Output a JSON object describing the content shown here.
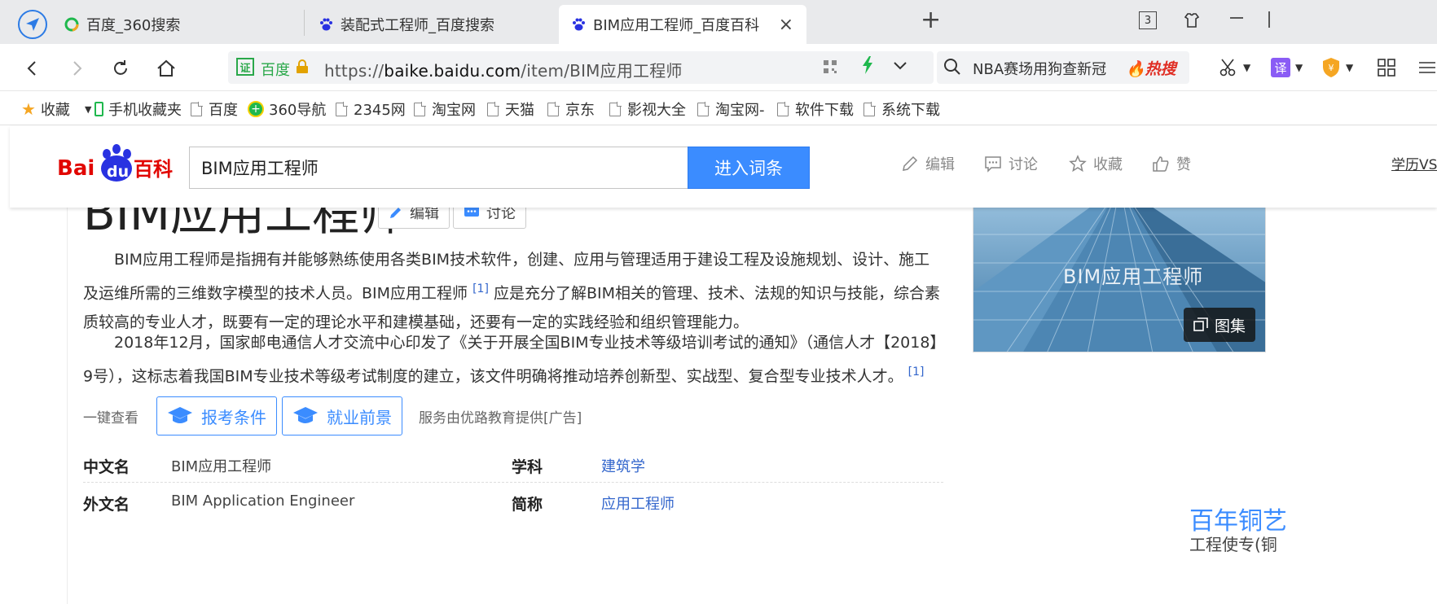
{
  "browser": {
    "tabs": [
      {
        "label": "百度_360搜索"
      },
      {
        "label": "装配式工程师_百度搜索"
      },
      {
        "label": "BIM应用工程师_百度百科",
        "close": "×"
      }
    ],
    "new_tab": "+",
    "tab_count": "3",
    "address": {
      "cert": "证",
      "site": "百度",
      "url_prefix": "https://",
      "url_host": "baike.baidu.com",
      "url_path": "/item/BIM应用工程师"
    },
    "search": {
      "query": "NBA赛场用狗查新冠",
      "hot_label": "热搜"
    },
    "translate_label": "译"
  },
  "bookmarks": [
    {
      "label": "收藏"
    },
    {
      "label": "手机收藏夹"
    },
    {
      "label": "百度"
    },
    {
      "label": "360导航"
    },
    {
      "label": "2345网"
    },
    {
      "label": "淘宝网"
    },
    {
      "label": "天猫"
    },
    {
      "label": "京东"
    },
    {
      "label": "影视大全"
    },
    {
      "label": "淘宝网-"
    },
    {
      "label": "软件下载"
    },
    {
      "label": "系统下载"
    }
  ],
  "baike_header": {
    "logo_bai": "Bai",
    "logo_du": "du",
    "logo_baike": "百科",
    "search_value": "BIM应用工程师",
    "enter_button": "进入词条",
    "actions": {
      "edit": "编辑",
      "discuss": "讨论",
      "collect": "收藏",
      "like": "赞"
    },
    "edu_link": "学历VS"
  },
  "article": {
    "title": "BIM应用工程师",
    "edit_button": "编辑",
    "discuss_button": "讨论",
    "para1_a": "BIM应用工程师是指拥有并能够熟练使用各类BIM技术软件，创建、应用与管理适用于建设工程及设施规划、设计、施工及运维所需的三维数字模型的技术人员。BIM应用工程师 ",
    "para1_ref": "[1]",
    "para1_b": " 应是充分了解BIM相关的管理、技术、法规的知识与技能，综合素质较高的专业人才，既要有一定的理论水平和建模基础，还要有一定的实践经验和组织管理能力。",
    "para2_a": "2018年12月，国家邮电通信人才交流中心印发了《关于开展全国BIM专业技术等级培训考试的通知》（通信人才【2018】9号），这标志着我国BIM专业技术等级考试制度的建立，该文件明确将推动培养创新型、实战型、复合型专业技术人才。 ",
    "para2_ref": "[1]",
    "quick_label": "一键查看",
    "quick_btn1": "报考条件",
    "quick_btn2": "就业前景",
    "service_text": "服务由优路教育提供[广告]",
    "info": [
      {
        "k1": "中文名",
        "v1": "BIM应用工程师",
        "k2": "学科",
        "v2": "建筑学"
      },
      {
        "k1": "外文名",
        "v1": "BIM Application Engineer",
        "k2": "简称",
        "v2": "应用工程师"
      }
    ],
    "album_caption": "BIM应用工程师",
    "album_button": "图集",
    "ad_title": "百年铜艺",
    "ad_sub": "工程使专(铜"
  },
  "colors": {
    "accent": "#3b8cff",
    "link": "#3366cc",
    "logo_red": "#e10601",
    "logo_blue": "#2932e1"
  }
}
